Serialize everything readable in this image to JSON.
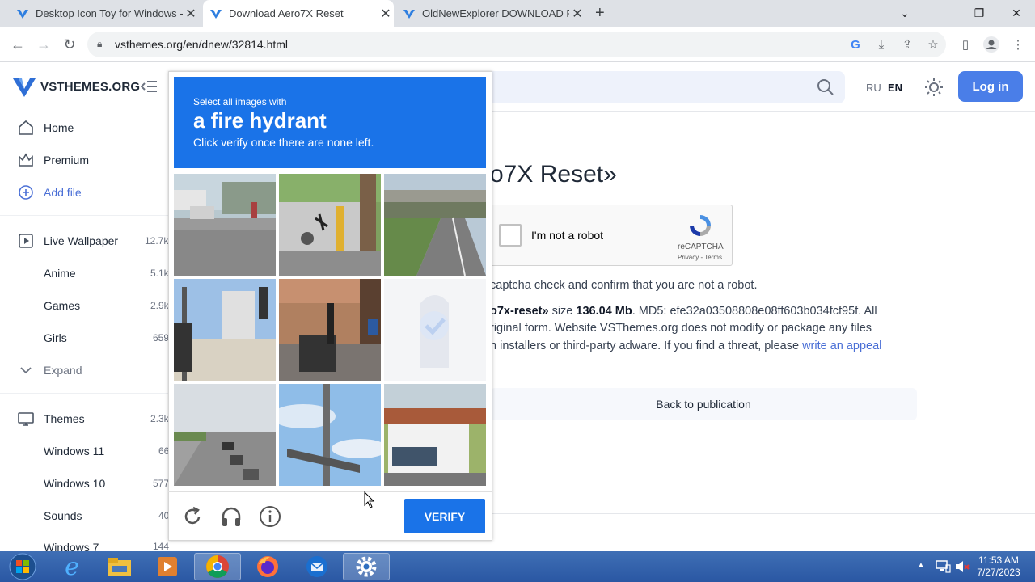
{
  "browser": {
    "tabs": [
      {
        "title": "Desktop Icon Toy for Windows - "
      },
      {
        "title": "Download Aero7X Reset"
      },
      {
        "title": "OldNewExplorer DOWNLOAD FR"
      }
    ],
    "url": "vsthemes.org/en/dnew/32814.html"
  },
  "site": {
    "logo": "VSTHEMES.ORG",
    "lang_ru": "RU",
    "lang_en": "EN",
    "login": "Log in",
    "nav": [
      {
        "label": "Home",
        "icon": "home-icon"
      },
      {
        "label": "Premium",
        "icon": "crown-icon"
      },
      {
        "label": "Add file",
        "icon": "plus-circle-icon"
      },
      {
        "label": "Live Wallpaper",
        "icon": "play-icon",
        "count": "12.7k"
      },
      {
        "label": "Anime",
        "count": "5.1k"
      },
      {
        "label": "Games",
        "count": "2.9k"
      },
      {
        "label": "Girls",
        "count": "659"
      },
      {
        "label": "Expand",
        "icon": "chevron-down-icon"
      },
      {
        "label": "Themes",
        "icon": "monitor-icon",
        "count": "2.3k"
      },
      {
        "label": "Windows 11",
        "count": "66"
      },
      {
        "label": "Windows 10",
        "count": "577"
      },
      {
        "label": "Sounds",
        "count": "40"
      },
      {
        "label": "Windows 7",
        "count": "144"
      }
    ]
  },
  "content": {
    "heading": "o7X Reset»",
    "recaptcha_label": "I'm not a robot",
    "recaptcha_brand": "reCAPTCHA",
    "recaptcha_terms": "Privacy - Terms",
    "p1": "captcha check and confirm that you are not a robot.",
    "p2_bold1": "o7x-reset»",
    "p2_a": " size ",
    "p2_bold2": "136.04 Mb",
    "p2_b": ". MD5: efe32a03508808e08ff603b034fcf95f. All",
    "p3": "riginal form. Website VSThemes.org does not modify or package any files",
    "p4": "n installers or third-party adware. If you find a threat, please ",
    "p4_link": "write an appeal",
    "back": "Back to publication"
  },
  "captcha": {
    "line1": "Select all images with",
    "line2": "a fire hydrant",
    "line3": "Click verify once there are none left.",
    "verify": "VERIFY"
  },
  "taskbar": {
    "time": "11:53 AM",
    "date": "7/27/2023"
  }
}
